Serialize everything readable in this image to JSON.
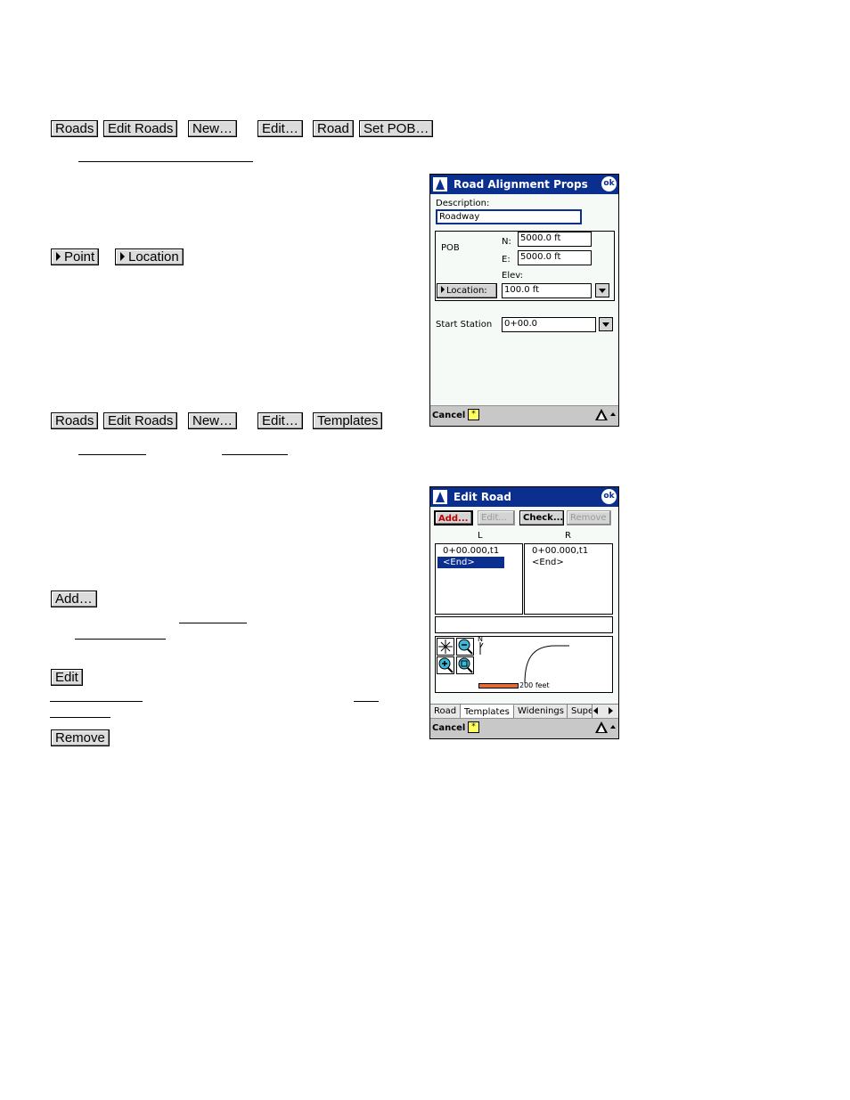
{
  "section1": {
    "buttons": [
      "Roads",
      "Edit Roads",
      "New…",
      "Edit…",
      "Road",
      "Set POB…"
    ],
    "point_buttons": [
      "Point",
      "Location"
    ]
  },
  "section2": {
    "buttons": [
      "Roads",
      "Edit Roads",
      "New…",
      "Edit…",
      "Templates"
    ],
    "add_label": "Add…",
    "edit_label": "Edit",
    "remove_label": "Remove"
  },
  "screen1": {
    "title": "Road Alignment Props",
    "ok": "ok",
    "description_label": "Description:",
    "description_value": "Roadway",
    "pob_label": "POB",
    "n_label": "N:",
    "n_value": "5000.0 ft",
    "e_label": "E:",
    "e_value": "5000.0 ft",
    "elev_label": "Elev:",
    "location_label": "Location:",
    "elev_value": "100.0 ft",
    "start_station_label": "Start Station",
    "start_station_value": "0+00.0",
    "cancel": "Cancel",
    "sip": "*"
  },
  "screen2": {
    "title": "Edit Road",
    "ok": "ok",
    "buttons": {
      "add": "Add...",
      "edit": "Edit...",
      "check": "Check...",
      "remove": "Remove"
    },
    "col_left": "L",
    "col_right": "R",
    "left_items": [
      "0+00.000,t1",
      "<End>"
    ],
    "right_items": [
      "0+00.000,t1",
      "<End>"
    ],
    "north": "N",
    "scale_label": "200 feet",
    "tabs": [
      "Road",
      "Templates",
      "Widenings",
      "Supe"
    ],
    "active_tab": "Templates",
    "cancel": "Cancel",
    "sip": "*",
    "colors": {
      "title": "#0b2f8f",
      "scale": "#e06a3a",
      "add": "#c00000"
    }
  }
}
